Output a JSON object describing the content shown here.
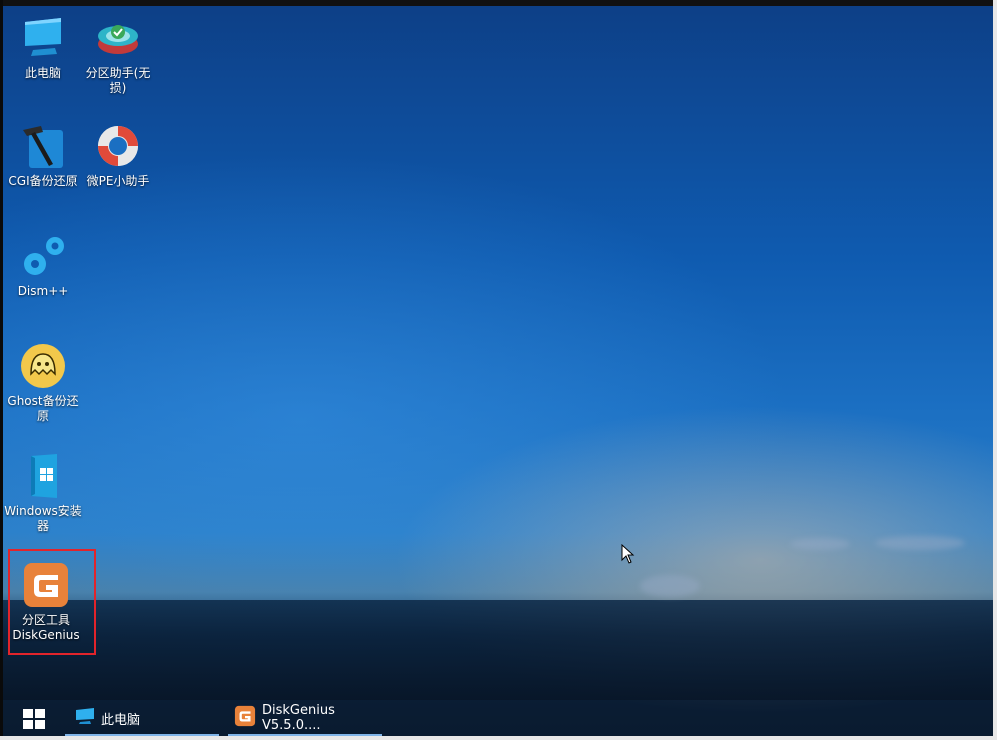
{
  "desktop": {
    "icons": [
      {
        "name": "this-pc",
        "label": "此电脑",
        "icon": "monitor-icon"
      },
      {
        "name": "partition-assistant",
        "label": "分区助手(无损)",
        "icon": "partition-assistant-icon"
      },
      {
        "name": "cgi-backup",
        "label": "CGI备份还原",
        "icon": "cgi-hammer-icon"
      },
      {
        "name": "micro-pe-helper",
        "label": "微PE小助手",
        "icon": "lifebuoy-icon"
      },
      {
        "name": "dism",
        "label": "Dism++",
        "icon": "gears-icon"
      },
      {
        "name": "ghost-backup",
        "label": "Ghost备份还原",
        "icon": "ghost-icon"
      },
      {
        "name": "windows-installer",
        "label": "Windows安装器",
        "icon": "windows-installer-icon"
      },
      {
        "name": "diskgenius",
        "label_line1": "分区工具",
        "label_line2": "DiskGenius",
        "icon": "diskgenius-icon"
      }
    ]
  },
  "taskbar": {
    "start_icon": "windows-logo-icon",
    "items": [
      {
        "label": "此电脑",
        "icon": "monitor-icon"
      },
      {
        "label": "DiskGenius V5.5.0....",
        "icon": "diskgenius-icon"
      }
    ]
  },
  "colors": {
    "selection_border": "#e2242b",
    "desktop_blue": "#1b6fc2",
    "diskgenius_orange": "#e8823a"
  }
}
